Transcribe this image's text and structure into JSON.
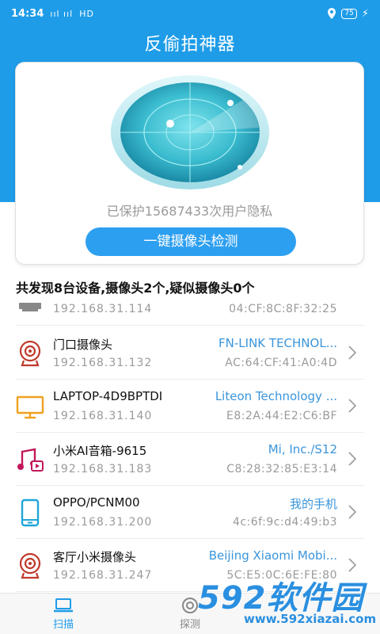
{
  "status_bar": {
    "time": "14:34",
    "signal": "ııl ııl",
    "wifi": "HD",
    "battery": "75"
  },
  "header": {
    "title": "反偷拍神器"
  },
  "card": {
    "protect_text": "已保护15687433次用户隐私",
    "scan_button": "一键摄像头检测"
  },
  "summary": "共发现8台设备,摄像头2个,疑似摄像头0个",
  "devices": [
    {
      "name": "",
      "ip": "192.168.31.114",
      "vendor": "",
      "mac": "04:CF:8C:8F:32:25",
      "icon": "pc-icon"
    },
    {
      "name": "门口摄像头",
      "ip": "192.168.31.132",
      "vendor": "FN-LINK TECHNOL...",
      "mac": "AC:64:CF:41:A0:4D",
      "icon": "webcam-icon"
    },
    {
      "name": "LAPTOP-4D9BPTDI",
      "ip": "192.168.31.140",
      "vendor": "Liteon Technology ...",
      "mac": "E8:2A:44:E2:C6:BF",
      "icon": "monitor-icon"
    },
    {
      "name": "小米AI音箱-9615",
      "ip": "192.168.31.183",
      "vendor": "Mi, Inc./S12",
      "mac": "C8:28:32:85:E3:14",
      "icon": "music-icon"
    },
    {
      "name": "OPPO/PCNM00",
      "ip": "192.168.31.200",
      "vendor": "我的手机",
      "mac": "4c:6f:9c:d4:49:b3",
      "icon": "phone-icon"
    },
    {
      "name": "客厅小米摄像头",
      "ip": "192.168.31.247",
      "vendor": "Beijing Xiaomi Mobi...",
      "mac": "5C:E5:0C:6E:FE:80",
      "icon": "webcam-icon"
    }
  ],
  "tabs": [
    {
      "label": "扫描",
      "active": true
    },
    {
      "label": "探测",
      "active": false
    }
  ],
  "watermark": {
    "brand": "592软件园",
    "url": "www.592xiazai.com"
  },
  "colors": {
    "primary": "#1e9ce8",
    "accent_text": "#3a95db",
    "cam_icon": "#c0392b",
    "monitor_icon": "#f0a020",
    "music_icon": "#c2185b",
    "phone_icon": "#1fa6d8"
  }
}
